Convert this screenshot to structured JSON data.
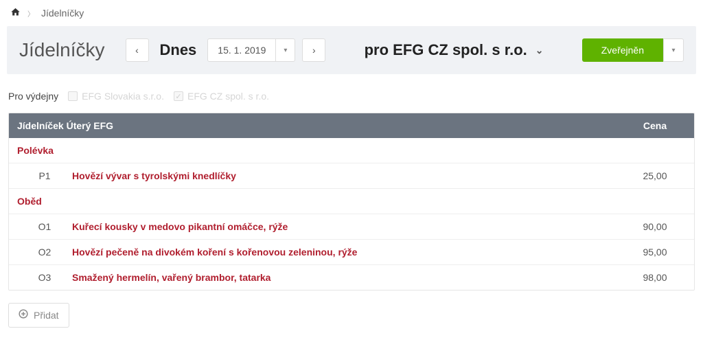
{
  "breadcrumb": {
    "current": "Jídelníčky"
  },
  "header": {
    "title": "Jídelníčky",
    "today_label": "Dnes",
    "date": "15. 1. 2019",
    "company_prefix": "pro",
    "company": "EFG CZ spol. s r.o.",
    "status_label": "Zveřejněn"
  },
  "filter": {
    "label": "Pro výdejny",
    "opts": [
      {
        "label": "EFG Slovakia s.r.o.",
        "checked": false
      },
      {
        "label": "EFG CZ spol. s r.o.",
        "checked": true
      }
    ]
  },
  "table": {
    "header_name": "Jídelníček Úterý EFG",
    "header_price": "Cena",
    "sections": [
      {
        "title": "Polévka",
        "items": [
          {
            "code": "P1",
            "name": "Hovězí vývar s tyrolskými knedlíčky",
            "price": "25,00"
          }
        ]
      },
      {
        "title": "Oběd",
        "items": [
          {
            "code": "O1",
            "name": "Kuřecí kousky v medovo pikantní omáčce, rýže",
            "price": "90,00"
          },
          {
            "code": "O2",
            "name": "Hovězí pečeně na divokém koření s kořenovou zeleninou, rýže",
            "price": "95,00"
          },
          {
            "code": "O3",
            "name": "Smažený hermelín, vařený brambor, tatarka",
            "price": "98,00"
          }
        ]
      }
    ]
  },
  "actions": {
    "add_label": "Přidat"
  },
  "colors": {
    "accent_green": "#5fb200",
    "accent_red": "#b01e2e",
    "header_gray": "#6b7480"
  }
}
